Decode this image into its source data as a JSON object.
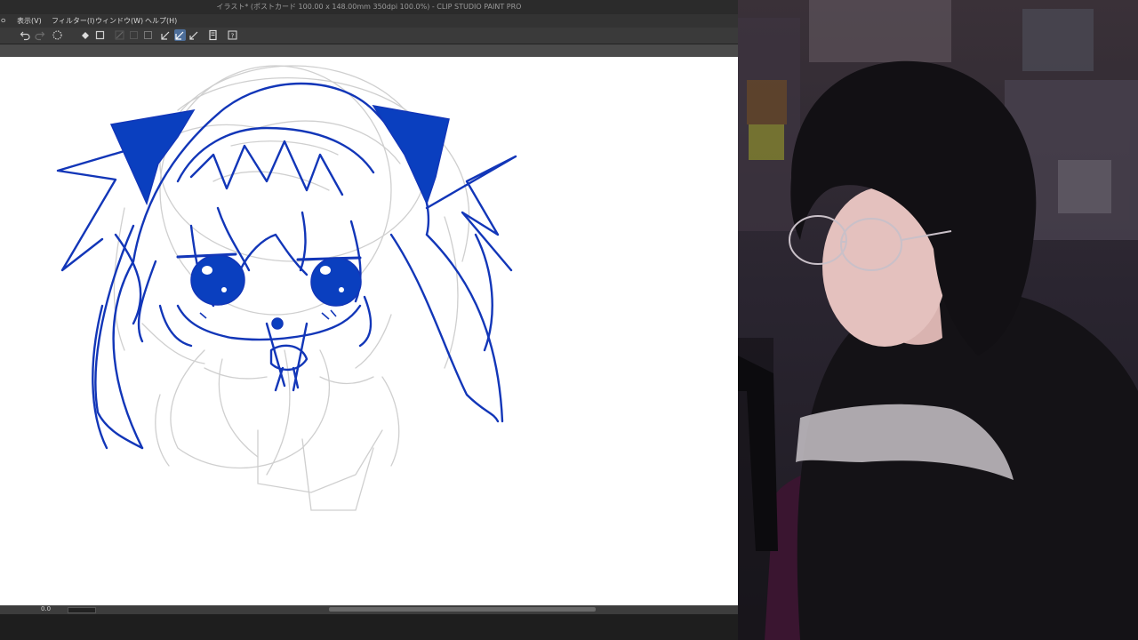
{
  "window": {
    "title": "イラスト* (ポストカード 100.00 x 148.00mm 350dpi 100.0%) - CLIP STUDIO PAINT PRO"
  },
  "menu": {
    "items": [
      "表示(V)",
      "フィルター(I)",
      "ウィンドウ(W)",
      "ヘルプ(H)"
    ]
  },
  "toolbar": {
    "icons": [
      "undo-icon",
      "redo-icon",
      "select-icon",
      "fill-icon",
      "crop-icon",
      "pen-stabilize-icon",
      "pen-active-icon",
      "ruler-icon",
      "layer-icon",
      "help-icon"
    ]
  },
  "status": {
    "zoom": "0.0"
  },
  "colors": {
    "ink": "#1236b8",
    "ink_fill": "#0a3fbf",
    "sketch": "#c8c8c8",
    "canvas": "#ffffff",
    "ui_dark": "#2d2d2d"
  }
}
